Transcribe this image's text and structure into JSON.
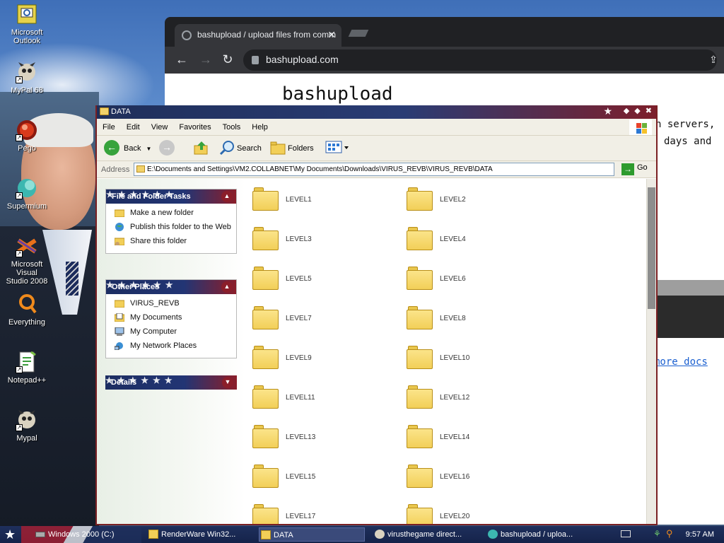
{
  "desktop": {
    "icons": [
      {
        "label": "Microsoft\nOutlook",
        "icon": "outlook-icon"
      },
      {
        "label": "MyPal 68",
        "icon": "mypal-icon"
      },
      {
        "label": "Pego",
        "icon": "pego-icon"
      },
      {
        "label": "Supermium",
        "icon": "supermium-icon"
      },
      {
        "label": "Microsoft Visual\nStudio 2008",
        "icon": "visual-studio-icon"
      },
      {
        "label": "Everything",
        "icon": "everything-icon"
      },
      {
        "label": "Notepad++",
        "icon": "notepadpp-icon"
      },
      {
        "label": "Mypal",
        "icon": "mypal-icon"
      }
    ]
  },
  "browser": {
    "tab_title": "bashupload / upload files from comm",
    "url": "bashupload.com",
    "page_title": "bashupload",
    "line1": "n servers,",
    "line2": "days and",
    "link": "more docs"
  },
  "explorer": {
    "title": "DATA",
    "menu": [
      "File",
      "Edit",
      "View",
      "Favorites",
      "Tools",
      "Help"
    ],
    "toolbar": {
      "back": "Back",
      "search": "Search",
      "folders": "Folders"
    },
    "address_label": "Address",
    "address_path": "E:\\Documents and Settings\\VM2.COLLABNET\\My Documents\\Downloads\\VIRUS_REVB\\VIRUS_REVB\\DATA",
    "go_label": "Go",
    "panels": {
      "tasks": {
        "title": "File and Folder Tasks",
        "items": [
          "Make a new folder",
          "Publish this folder to the Web",
          "Share this folder"
        ]
      },
      "places": {
        "title": "Other Places",
        "items": [
          "VIRUS_REVB",
          "My Documents",
          "My Computer",
          "My Network Places"
        ]
      },
      "details": {
        "title": "Details"
      }
    },
    "folders": [
      "LEVEL1",
      "LEVEL2",
      "LEVEL3",
      "LEVEL4",
      "LEVEL5",
      "LEVEL6",
      "LEVEL7",
      "LEVEL8",
      "LEVEL9",
      "LEVEL10",
      "LEVEL11",
      "LEVEL12",
      "LEVEL13",
      "LEVEL14",
      "LEVEL15",
      "LEVEL16",
      "LEVEL17",
      "LEVEL20"
    ]
  },
  "taskbar": {
    "items": [
      "Windows 2000 (C:)",
      "RenderWare Win32...",
      "DATA",
      "virusthegame direct...",
      "bashupload / uploa..."
    ],
    "clock": "9:57 AM"
  },
  "colors": {
    "title_navy": "#1f2f5a",
    "title_red": "#7d1f2b",
    "folder_yellow": "#f2cf58"
  }
}
